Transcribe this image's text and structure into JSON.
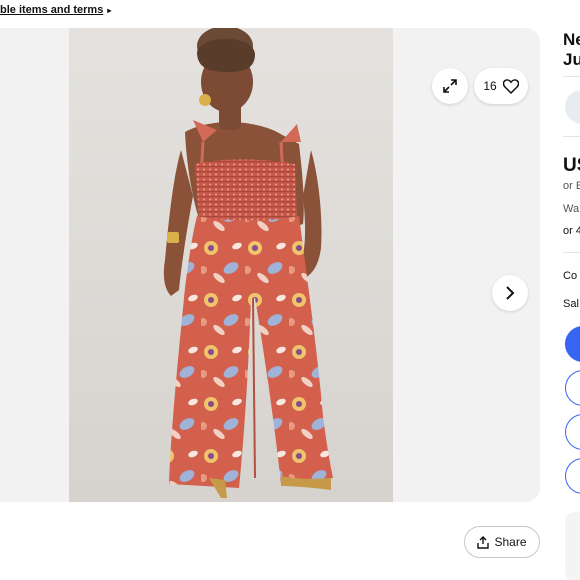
{
  "top_link": {
    "text": "ble items and terms",
    "arrow": "▸"
  },
  "gallery": {
    "like_count": "16",
    "icons": {
      "expand": "expand-icon",
      "like": "heart-icon",
      "next": "chevron-right-icon"
    },
    "photo": "model-in-floral-jumpsuit"
  },
  "share": {
    "label": "Share",
    "icon": "share-icon"
  },
  "side": {
    "title_line1": "Ne",
    "title_line2": "Ju",
    "price": "US",
    "or_best": "or E",
    "watchers": "Wa",
    "or_installments": "or 4",
    "condition": "Co",
    "sale": "Sal"
  },
  "colors": {
    "accent": "#3665f3",
    "jumpsuit": "#d4614f"
  }
}
